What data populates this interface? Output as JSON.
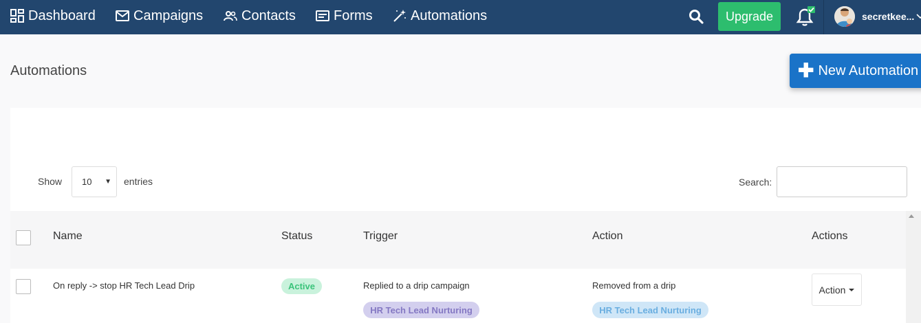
{
  "nav": {
    "items": [
      {
        "label": "Dashboard",
        "icon": "dashboard-icon"
      },
      {
        "label": "Campaigns",
        "icon": "mail-icon"
      },
      {
        "label": "Contacts",
        "icon": "users-icon"
      },
      {
        "label": "Forms",
        "icon": "form-icon"
      },
      {
        "label": "Automations",
        "icon": "magic-wand-icon"
      }
    ],
    "upgrade_label": "Upgrade",
    "username": "secretkee...",
    "accent": "#2dbd6e",
    "bg": "#22466e"
  },
  "page": {
    "title": "Automations",
    "new_button_label": "New Automation",
    "new_button_color": "#1a73c8"
  },
  "table_controls": {
    "show_label": "Show",
    "page_length": "10",
    "entries_label": "entries",
    "search_label": "Search:",
    "search_value": ""
  },
  "table": {
    "columns": [
      "Name",
      "Status",
      "Trigger",
      "Action",
      "Actions"
    ],
    "rows": [
      {
        "name": "On reply -> stop HR Tech Lead Drip",
        "status": "Active",
        "trigger": "Replied to a drip campaign",
        "trigger_tag": "HR Tech Lead Nurturing",
        "action": "Removed from a drip",
        "action_tag": "HR Tech Lead Nurturing",
        "actions_label": "Action"
      }
    ]
  }
}
